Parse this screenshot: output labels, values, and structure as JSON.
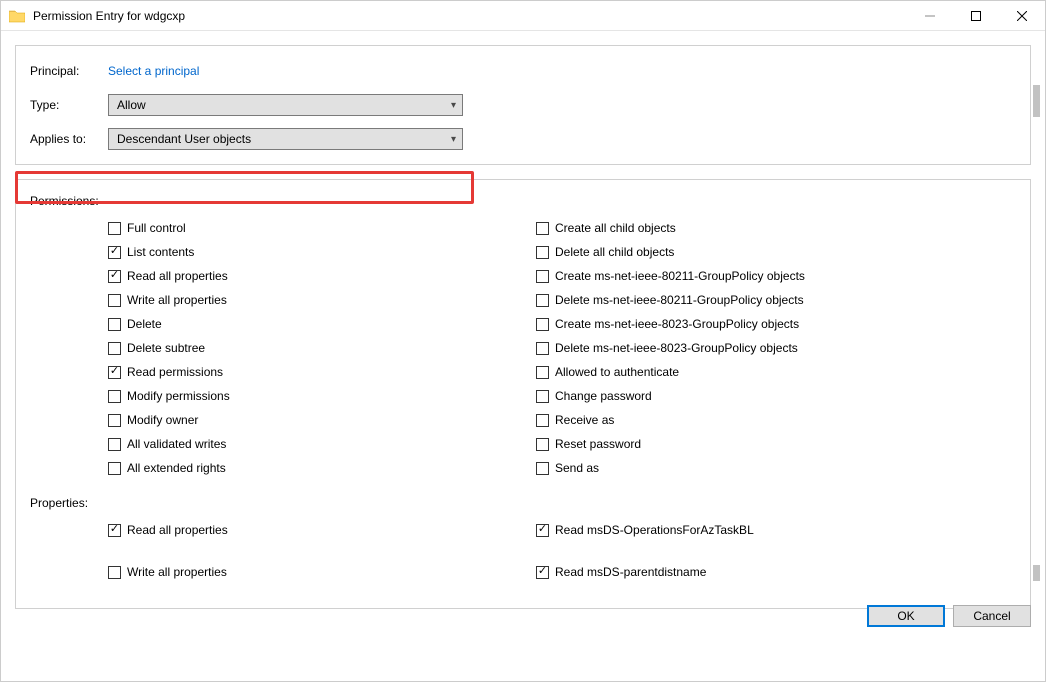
{
  "window": {
    "title": "Permission Entry for wdgcxp"
  },
  "header": {
    "labels": {
      "principal": "Principal:",
      "type": "Type:",
      "applies_to": "Applies to:"
    },
    "principal_link": "Select a principal",
    "type_value": "Allow",
    "applies_to_value": "Descendant User objects"
  },
  "sections": {
    "permissions": "Permissions:",
    "properties": "Properties:"
  },
  "permissions_left": [
    {
      "label": "Full control",
      "checked": false
    },
    {
      "label": "List contents",
      "checked": true
    },
    {
      "label": "Read all properties",
      "checked": true
    },
    {
      "label": "Write all properties",
      "checked": false
    },
    {
      "label": "Delete",
      "checked": false
    },
    {
      "label": "Delete subtree",
      "checked": false
    },
    {
      "label": "Read permissions",
      "checked": true
    },
    {
      "label": "Modify permissions",
      "checked": false
    },
    {
      "label": "Modify owner",
      "checked": false
    },
    {
      "label": "All validated writes",
      "checked": false
    },
    {
      "label": "All extended rights",
      "checked": false
    }
  ],
  "permissions_right": [
    {
      "label": "Create all child objects",
      "checked": false
    },
    {
      "label": "Delete all child objects",
      "checked": false
    },
    {
      "label": "Create ms-net-ieee-80211-GroupPolicy objects",
      "checked": false
    },
    {
      "label": "Delete ms-net-ieee-80211-GroupPolicy objects",
      "checked": false
    },
    {
      "label": "Create ms-net-ieee-8023-GroupPolicy objects",
      "checked": false
    },
    {
      "label": "Delete ms-net-ieee-8023-GroupPolicy objects",
      "checked": false
    },
    {
      "label": "Allowed to authenticate",
      "checked": false
    },
    {
      "label": "Change password",
      "checked": false
    },
    {
      "label": "Receive as",
      "checked": false
    },
    {
      "label": "Reset password",
      "checked": false
    },
    {
      "label": "Send as",
      "checked": false
    }
  ],
  "properties_left": [
    {
      "label": "Read all properties",
      "checked": true
    },
    {
      "label": "Write all properties",
      "checked": false
    }
  ],
  "properties_right": [
    {
      "label": "Read msDS-OperationsForAzTaskBL",
      "checked": true
    },
    {
      "label": "Read msDS-parentdistname",
      "checked": true
    }
  ],
  "footer": {
    "ok": "OK",
    "cancel": "Cancel"
  }
}
